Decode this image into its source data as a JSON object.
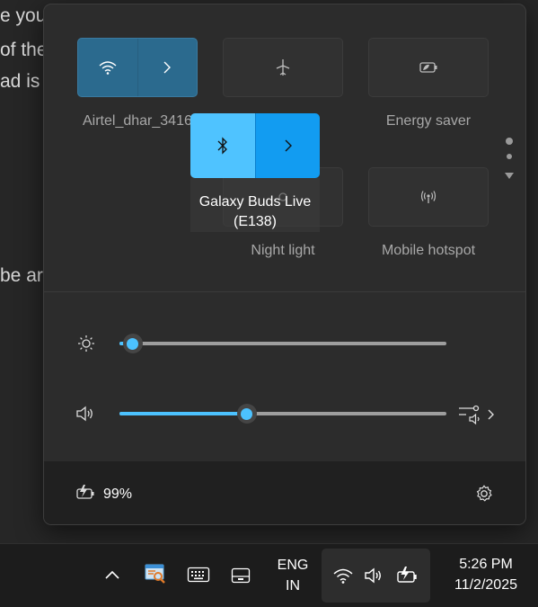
{
  "background_text": [
    "e you",
    "of the",
    "ad is",
    "be ar"
  ],
  "quick_settings": {
    "tiles": [
      {
        "label": "Airtel_dhar_3416",
        "icon": "wifi-icon",
        "state": "on"
      },
      {
        "label": "de",
        "icon": "airplane-icon",
        "state": "off"
      },
      {
        "label": "Energy saver",
        "icon": "energy-saver-icon",
        "state": "off"
      },
      {
        "label": "Night light",
        "icon": "night-light-icon",
        "state": "off"
      },
      {
        "label": "Mobile hotspot",
        "icon": "hotspot-icon",
        "state": "off"
      }
    ],
    "bluetooth_drag": {
      "label_line1": "Galaxy Buds Live",
      "label_line2": "(E138)",
      "icon": "bluetooth-icon",
      "state": "on"
    },
    "brightness": {
      "icon": "brightness-icon",
      "level": 0.04
    },
    "volume": {
      "icon": "speaker-icon",
      "level": 0.39,
      "extra_icon": "audio-output-icon"
    },
    "battery_text": "99%",
    "settings_icon": "gear-icon"
  },
  "taskbar": {
    "language_line1": "ENG",
    "language_line2": "IN",
    "time": "5:26 PM",
    "date": "11/2/2025",
    "icons": [
      "chevron-up-icon",
      "search-app-icon",
      "keyboard-icon",
      "tablet-icon",
      "wifi-icon",
      "speaker-icon",
      "battery-icon"
    ]
  },
  "colors": {
    "accent": "#4cc2ff",
    "accent_dark": "#129cf1",
    "tile_on": "#2b6a8e"
  }
}
